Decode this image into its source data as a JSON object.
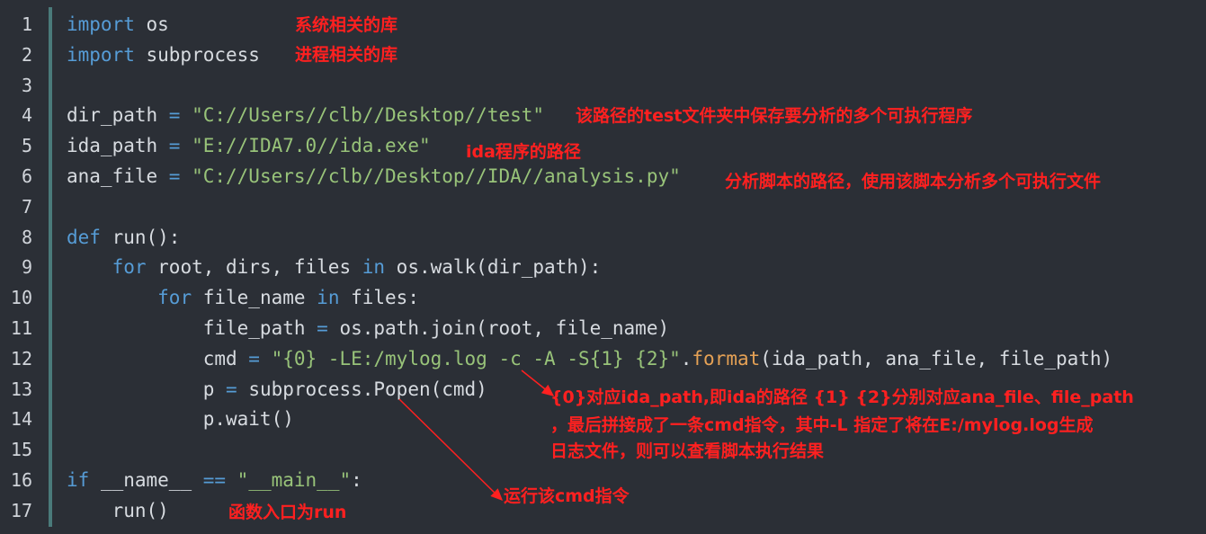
{
  "lines": [
    {
      "n": "1",
      "tokens": [
        {
          "t": "import",
          "c": "kw"
        },
        {
          "t": " os",
          "c": ""
        }
      ]
    },
    {
      "n": "2",
      "tokens": [
        {
          "t": "import",
          "c": "kw"
        },
        {
          "t": " subprocess",
          "c": ""
        }
      ]
    },
    {
      "n": "3",
      "tokens": []
    },
    {
      "n": "4",
      "tokens": [
        {
          "t": "dir_path ",
          "c": ""
        },
        {
          "t": "=",
          "c": "op"
        },
        {
          "t": " \"C://Users//clb//Desktop//test\"",
          "c": "str"
        }
      ]
    },
    {
      "n": "5",
      "tokens": [
        {
          "t": "ida_path ",
          "c": ""
        },
        {
          "t": "=",
          "c": "op"
        },
        {
          "t": " \"E://IDA7.0//ida.exe\"",
          "c": "str"
        }
      ]
    },
    {
      "n": "6",
      "tokens": [
        {
          "t": "ana_file ",
          "c": ""
        },
        {
          "t": "=",
          "c": "op"
        },
        {
          "t": " \"C://Users//clb//Desktop//IDA//analysis.py\"",
          "c": "str"
        }
      ]
    },
    {
      "n": "7",
      "tokens": []
    },
    {
      "n": "8",
      "tokens": [
        {
          "t": "def",
          "c": "kw"
        },
        {
          "t": " run():",
          "c": ""
        }
      ]
    },
    {
      "n": "9",
      "tokens": [
        {
          "t": "    ",
          "c": ""
        },
        {
          "t": "for",
          "c": "kw"
        },
        {
          "t": " root, dirs, files ",
          "c": ""
        },
        {
          "t": "in",
          "c": "kw"
        },
        {
          "t": " os.walk(dir_path):",
          "c": ""
        }
      ]
    },
    {
      "n": "10",
      "tokens": [
        {
          "t": "        ",
          "c": ""
        },
        {
          "t": "for",
          "c": "kw"
        },
        {
          "t": " file_name ",
          "c": ""
        },
        {
          "t": "in",
          "c": "kw"
        },
        {
          "t": " files:",
          "c": ""
        }
      ]
    },
    {
      "n": "11",
      "tokens": [
        {
          "t": "            file_path ",
          "c": ""
        },
        {
          "t": "=",
          "c": "op"
        },
        {
          "t": " os.path.join(root, file_name)",
          "c": ""
        }
      ]
    },
    {
      "n": "12",
      "tokens": [
        {
          "t": "            cmd ",
          "c": ""
        },
        {
          "t": "=",
          "c": "op"
        },
        {
          "t": " \"{0} -LE:/mylog.log -c -A -S{1} {2}\"",
          "c": "str"
        },
        {
          "t": ".",
          "c": ""
        },
        {
          "t": "format",
          "c": "fn"
        },
        {
          "t": "(ida_path, ana_file, file_path)",
          "c": ""
        }
      ]
    },
    {
      "n": "13",
      "tokens": [
        {
          "t": "            p ",
          "c": ""
        },
        {
          "t": "=",
          "c": "op"
        },
        {
          "t": " subprocess.Popen(cmd)",
          "c": ""
        }
      ]
    },
    {
      "n": "14",
      "tokens": [
        {
          "t": "            p.wait()",
          "c": ""
        }
      ]
    },
    {
      "n": "15",
      "tokens": []
    },
    {
      "n": "16",
      "tokens": [
        {
          "t": "if",
          "c": "kw"
        },
        {
          "t": " __name__ ",
          "c": ""
        },
        {
          "t": "==",
          "c": "op"
        },
        {
          "t": " \"__main__\"",
          "c": "str"
        },
        {
          "t": ":",
          "c": ""
        }
      ]
    },
    {
      "n": "17",
      "tokens": [
        {
          "t": "    run()",
          "c": ""
        }
      ]
    }
  ],
  "annotations": {
    "a1": "系统相关的库",
    "a2": "进程相关的库",
    "a4": "该路径的test文件夹中保存要分析的多个可执行程序",
    "a5": "ida程序的路径",
    "a6": "分析脚本的路径，使用该脚本分析多个可执行文件",
    "a12_l1": "{0}对应ida_path,即ida的路径 {1} {2}分别对应ana_file、file_path",
    "a12_l2": "，最后拼接成了一条cmd指令，其中-L 指定了将在E:/mylog.log生成",
    "a12_l3": "日志文件，则可以查看脚本执行结果",
    "a13": "运行该cmd指令",
    "a17": "函数入口为run"
  },
  "colors": {
    "background": "#2b2f36",
    "keyword": "#569cd6",
    "string": "#98c379",
    "function": "#e5a155",
    "annotation": "#ff2020",
    "gutter": "#4a7a7a"
  }
}
